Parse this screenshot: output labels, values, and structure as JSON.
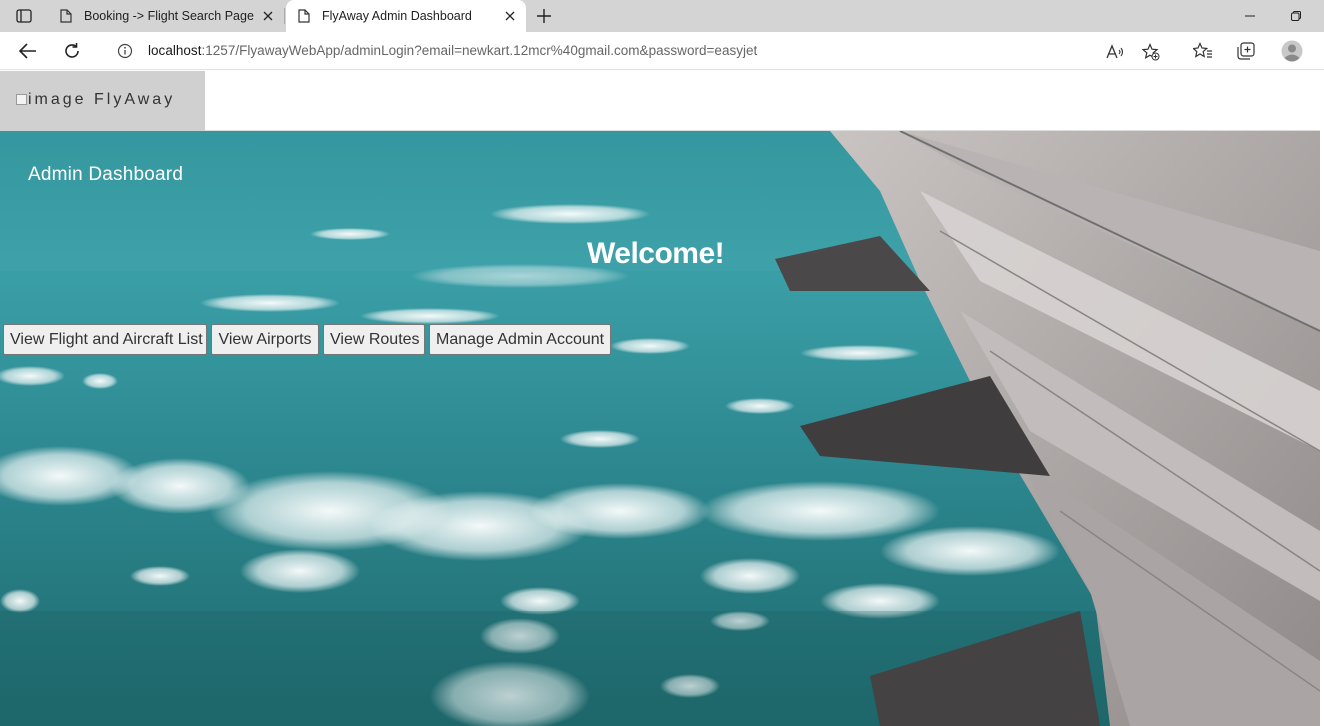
{
  "browser": {
    "tabs": [
      {
        "title": "Booking -> Flight Search Page",
        "active": false
      },
      {
        "title": "FlyAway Admin Dashboard",
        "active": true
      }
    ],
    "url": {
      "host": "localhost",
      "rest": ":1257/FlyawayWebApp/adminLogin?email=newkart.12mcr%40gmail.com&password=easyjet"
    },
    "icons": [
      "tab-actions-icon",
      "page-icon",
      "close-icon",
      "new-tab-icon",
      "minimize-icon",
      "restore-icon",
      "back-icon",
      "refresh-icon",
      "info-icon",
      "read-aloud-icon",
      "add-favorite-icon",
      "favorites-icon",
      "collections-icon",
      "profile-icon"
    ]
  },
  "site": {
    "brand_alt": "image",
    "brand_name": "FlyAway",
    "dashboard_title": "Admin Dashboard",
    "welcome": "Welcome!",
    "buttons": [
      {
        "label": "View Flight and Aircraft List"
      },
      {
        "label": "View Airports"
      },
      {
        "label": "View Routes"
      },
      {
        "label": "Manage Admin Account"
      }
    ]
  },
  "colors": {
    "tabbar_bg": "#d4d4d4",
    "sky_teal": "#2c9097",
    "button_bg": "#efefef",
    "button_border": "#767676",
    "brand_bg": "#d0d0d0"
  }
}
